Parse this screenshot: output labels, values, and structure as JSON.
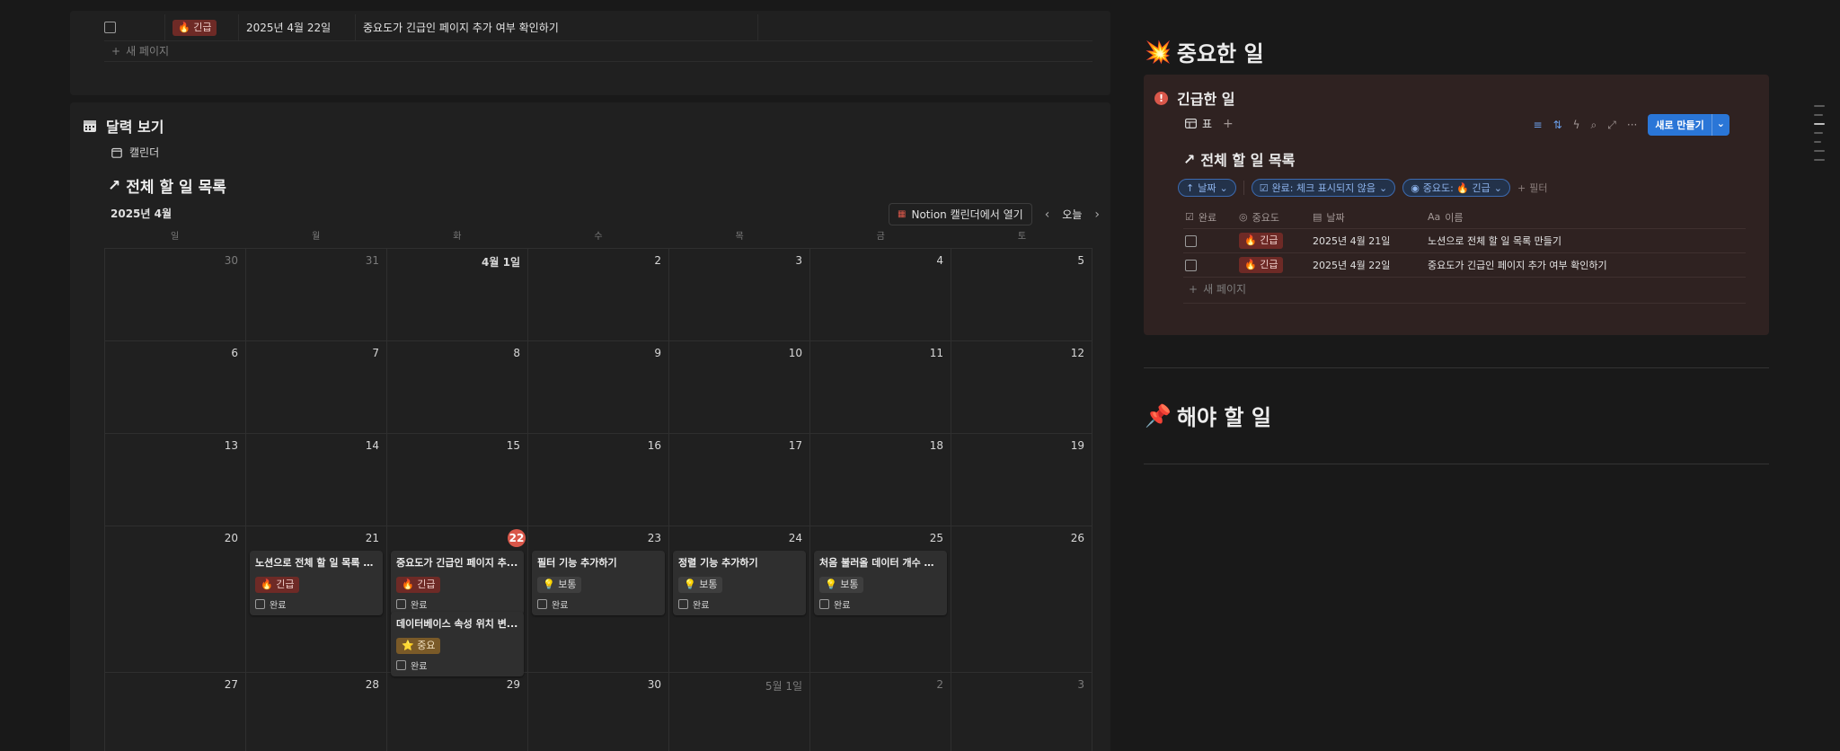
{
  "top_table": {
    "row": {
      "tag": "🔥 긴급",
      "date": "2025년 4월 22일",
      "name": "중요도가 긴급인 페이지 추가 여부 확인하기"
    },
    "new_page": "새 페이지"
  },
  "calendar": {
    "heading": "달력 보기",
    "view_tab": "캘린더",
    "title": "전체 할 일 목록",
    "month_label": "2025년 4월",
    "open_in_notion": "Notion 캘린더에서 열기",
    "today": "오늘",
    "weekdays": [
      "일",
      "월",
      "화",
      "수",
      "목",
      "금",
      "토"
    ],
    "weeks": [
      [
        "30",
        "31",
        "4월 1일",
        "2",
        "3",
        "4",
        "5"
      ],
      [
        "6",
        "7",
        "8",
        "9",
        "10",
        "11",
        "12"
      ],
      [
        "13",
        "14",
        "15",
        "16",
        "17",
        "18",
        "19"
      ],
      [
        "20",
        "21",
        "22",
        "23",
        "24",
        "25",
        "26"
      ],
      [
        "27",
        "28",
        "29",
        "30",
        "5월 1일",
        "2",
        "3"
      ]
    ],
    "events": {
      "e21": {
        "title": "노션으로 전체 할 일 목록 만...",
        "tag": "🔥 긴급",
        "check": "완료"
      },
      "e22a": {
        "title": "중요도가 긴급인 페이지 추...",
        "tag": "🔥 긴급",
        "check": "완료"
      },
      "e22b": {
        "title": "데이터베이스 속성 위치 변...",
        "tag": "⭐ 중요",
        "check": "완료"
      },
      "e23": {
        "title": "필터 기능 추가하기",
        "tag": "💡 보통",
        "check": "완료"
      },
      "e24": {
        "title": "정렬 기능 추가하기",
        "tag": "💡 보통",
        "check": "완료"
      },
      "e25": {
        "title": "처음 불러올 데이터 개수 지...",
        "tag": "💡 보통",
        "check": "완료"
      }
    }
  },
  "important": {
    "heading": "중요한 일",
    "heading_icon": "💥",
    "panel_title": "긴급한 일",
    "tab_label": "표",
    "new_button": "새로 만들기",
    "db_title": "전체 할 일 목록",
    "filters": [
      "날짜",
      "완료: 체크 표시되지 않음",
      "중요도: 🔥 긴급"
    ],
    "add_filter": "필터",
    "columns": [
      "완료",
      "중요도",
      "날짜",
      "이름"
    ],
    "rows": [
      {
        "tag": "🔥 긴급",
        "date": "2025년 4월 21일",
        "name": "노션으로 전체 할 일 목록 만들기"
      },
      {
        "tag": "🔥 긴급",
        "date": "2025년 4월 22일",
        "name": "중요도가 긴급인 페이지 추가 여부 확인하기"
      }
    ],
    "new_page": "새 페이지"
  },
  "todo": {
    "heading": "해야 할 일",
    "heading_icon": "📌"
  },
  "colors": {
    "accent": "#2a76d7",
    "urgent_tag": "#6e2a26",
    "today": "#d9574a",
    "panel_bg": "#2f2221"
  }
}
